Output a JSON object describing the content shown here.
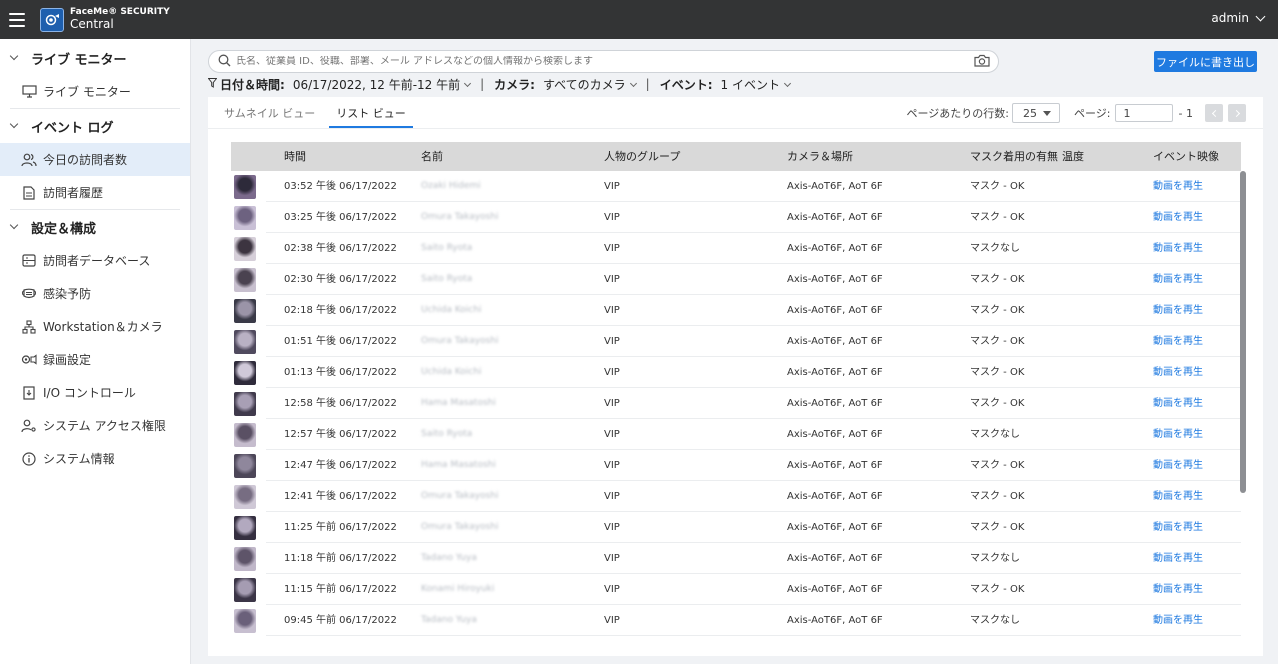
{
  "app": {
    "brand_line1": "FaceMe® SECURITY",
    "brand_line2": "Central",
    "user": "admin"
  },
  "sidebar": {
    "sections": [
      {
        "label": "ライブ モニター",
        "items": [
          {
            "label": "ライブ モニター",
            "icon": "monitor-icon"
          }
        ]
      },
      {
        "label": "イベント ログ",
        "items": [
          {
            "label": "今日の訪問者数",
            "icon": "people-icon",
            "active": true
          },
          {
            "label": "訪問者履歴",
            "icon": "document-icon"
          }
        ]
      },
      {
        "label": "設定＆構成",
        "items": [
          {
            "label": "訪問者データベース",
            "icon": "database-icon"
          },
          {
            "label": "感染予防",
            "icon": "mask-icon"
          },
          {
            "label": "Workstation＆カメラ",
            "icon": "network-icon"
          },
          {
            "label": "録画設定",
            "icon": "video-gear-icon"
          },
          {
            "label": "I/O コントロール",
            "icon": "io-icon"
          },
          {
            "label": "システム アクセス権限",
            "icon": "user-key-icon"
          },
          {
            "label": "システム情報",
            "icon": "info-icon"
          }
        ]
      }
    ]
  },
  "search": {
    "placeholder": "氏名、従業員 ID、役職、部署、メール アドレスなどの個人情報から検索します"
  },
  "export_label": "ファイルに書き出し",
  "filters": {
    "date_label": "日付＆時間:",
    "date_value": "06/17/2022, 12 午前-12 午前",
    "camera_label": "カメラ:",
    "camera_value": "すべてのカメラ",
    "event_label": "イベント:",
    "event_value": "1 イベント"
  },
  "tabs": [
    "サムネイル ビュー",
    "リスト ビュー"
  ],
  "pager": {
    "rows_label": "ページあたりの行数:",
    "rows_value": "25",
    "page_label": "ページ:",
    "page_value": "1",
    "page_total": "- 1"
  },
  "table": {
    "headers": {
      "time": "時間",
      "name": "名前",
      "group": "人物のグループ",
      "camera": "カメラ＆場所",
      "mask": "マスク着用の有無",
      "temp": "温度",
      "video": "イベント映像"
    },
    "rows": [
      {
        "time": "03:52 午後 06/17/2022",
        "name": "Ozaki Hidemi",
        "group": "VIP",
        "camera": "Axis-AoT6F, AoT 6F",
        "mask": "マスク - OK",
        "video": "動画を再生"
      },
      {
        "time": "03:25 午後 06/17/2022",
        "name": "Omura Takayoshi",
        "group": "VIP",
        "camera": "Axis-AoT6F, AoT 6F",
        "mask": "マスク - OK",
        "video": "動画を再生"
      },
      {
        "time": "02:38 午後 06/17/2022",
        "name": "Saito Ryota",
        "group": "VIP",
        "camera": "Axis-AoT6F, AoT 6F",
        "mask": "マスクなし",
        "video": "動画を再生"
      },
      {
        "time": "02:30 午後 06/17/2022",
        "name": "Saito Ryota",
        "group": "VIP",
        "camera": "Axis-AoT6F, AoT 6F",
        "mask": "マスク - OK",
        "video": "動画を再生"
      },
      {
        "time": "02:18 午後 06/17/2022",
        "name": "Uchida Koichi",
        "group": "VIP",
        "camera": "Axis-AoT6F, AoT 6F",
        "mask": "マスク - OK",
        "video": "動画を再生"
      },
      {
        "time": "01:51 午後 06/17/2022",
        "name": "Omura Takayoshi",
        "group": "VIP",
        "camera": "Axis-AoT6F, AoT 6F",
        "mask": "マスク - OK",
        "video": "動画を再生"
      },
      {
        "time": "01:13 午後 06/17/2022",
        "name": "Uchida Koichi",
        "group": "VIP",
        "camera": "Axis-AoT6F, AoT 6F",
        "mask": "マスク - OK",
        "video": "動画を再生"
      },
      {
        "time": "12:58 午後 06/17/2022",
        "name": "Hama Masatoshi",
        "group": "VIP",
        "camera": "Axis-AoT6F, AoT 6F",
        "mask": "マスク - OK",
        "video": "動画を再生"
      },
      {
        "time": "12:57 午後 06/17/2022",
        "name": "Saito Ryota",
        "group": "VIP",
        "camera": "Axis-AoT6F, AoT 6F",
        "mask": "マスクなし",
        "video": "動画を再生"
      },
      {
        "time": "12:47 午後 06/17/2022",
        "name": "Hama Masatoshi",
        "group": "VIP",
        "camera": "Axis-AoT6F, AoT 6F",
        "mask": "マスク - OK",
        "video": "動画を再生"
      },
      {
        "time": "12:41 午後 06/17/2022",
        "name": "Omura Takayoshi",
        "group": "VIP",
        "camera": "Axis-AoT6F, AoT 6F",
        "mask": "マスク - OK",
        "video": "動画を再生"
      },
      {
        "time": "11:25 午前 06/17/2022",
        "name": "Omura Takayoshi",
        "group": "VIP",
        "camera": "Axis-AoT6F, AoT 6F",
        "mask": "マスク - OK",
        "video": "動画を再生"
      },
      {
        "time": "11:18 午前 06/17/2022",
        "name": "Tadano Yuya",
        "group": "VIP",
        "camera": "Axis-AoT6F, AoT 6F",
        "mask": "マスクなし",
        "video": "動画を再生"
      },
      {
        "time": "11:15 午前 06/17/2022",
        "name": "Konami Hiroyuki",
        "group": "VIP",
        "camera": "Axis-AoT6F, AoT 6F",
        "mask": "マスク - OK",
        "video": "動画を再生"
      },
      {
        "time": "09:45 午前 06/17/2022",
        "name": "Tadano Yuya",
        "group": "VIP",
        "camera": "Axis-AoT6F, AoT 6F",
        "mask": "マスクなし",
        "video": "動画を再生"
      }
    ]
  },
  "colors": {
    "topbar": "#333435",
    "accent": "#1f7ae0",
    "active_item": "#e3edf9",
    "table_header": "#d9d9d9"
  }
}
